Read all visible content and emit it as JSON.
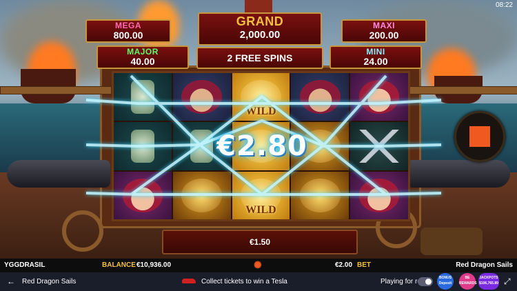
{
  "clock": "08:22",
  "jackpots": {
    "grand": {
      "label": "GRAND",
      "value": "2,000.00"
    },
    "mega": {
      "label": "MEGA",
      "value": "800.00"
    },
    "maxi": {
      "label": "MAXI",
      "value": "200.00"
    },
    "major": {
      "label": "MAJOR",
      "value": "40.00"
    },
    "mini": {
      "label": "MINI",
      "value": "24.00"
    }
  },
  "free_spins_text": "2 FREE SPINS",
  "reels": {
    "wild_label": "WILD",
    "grid": [
      [
        "bottle",
        "pirate-man",
        "golden-parrot-wild",
        "pirate-man",
        "pirate-girl"
      ],
      [
        "bottle",
        "bottle",
        "golden-parrot-wild",
        "golden-dragon",
        "crossed-swords"
      ],
      [
        "pirate-girl",
        "golden-dragon",
        "golden-parrot-wild",
        "golden-dragon",
        "pirate-girl"
      ]
    ]
  },
  "win_amount": "€2.80",
  "line_win": "€1.50",
  "status": {
    "brand": "YGGDRASIL",
    "balance_label": "BALANCE",
    "balance_value": "€10,936.00",
    "bet_value": "€2.00",
    "bet_label": "BET",
    "game_name": "Red Dragon Sails"
  },
  "bottom": {
    "back_icon": "arrow-left-icon",
    "title": "Red Dragon Sails",
    "promo_text": "Collect tickets to win a Tesla",
    "playing_label": "Playing for real",
    "badges": [
      {
        "line1": "BONUS",
        "line2": "Deposit",
        "color": "#2a6ae0"
      },
      {
        "line1": "BE",
        "line2": "REWARDS",
        "color": "#e03a8a"
      },
      {
        "line1": "JACKPOTS",
        "line2": "$106,765.89",
        "color": "#7a2ae0"
      }
    ]
  },
  "colors": {
    "jackpot_gold": "#f2c040",
    "mega_pink": "#ff6ab0",
    "maxi_pink": "#ff8ae0",
    "major_green": "#5aff6a",
    "mini_cyan": "#8af0ff",
    "stop_orange": "#f05a20"
  }
}
